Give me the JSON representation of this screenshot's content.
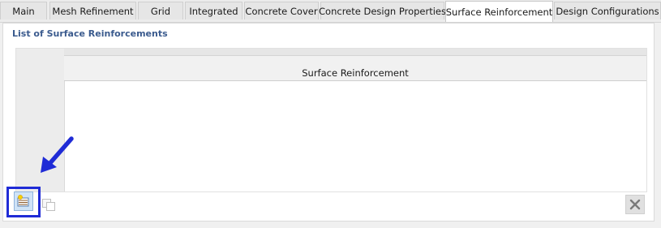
{
  "tabs": [
    {
      "label": "Main",
      "active": false
    },
    {
      "label": "Mesh Refinement",
      "active": false
    },
    {
      "label": "Grid",
      "active": false
    },
    {
      "label": "Integrated",
      "active": false
    },
    {
      "label": "Concrete Cover",
      "active": false
    },
    {
      "label": "Concrete Design Properties",
      "active": false
    },
    {
      "label": "Surface Reinforcement",
      "active": true
    },
    {
      "label": "Design Configurations",
      "active": false
    }
  ],
  "section": {
    "title": "List of Surface Reinforcements",
    "table": {
      "columns": [
        "Surface Reinforcement"
      ],
      "rows": []
    }
  },
  "toolbar": {
    "new_icon": "new-surface-reinforcement-icon",
    "copy_icon": "copy-icon",
    "delete_icon": "delete-icon"
  },
  "annotation": {
    "arrow_color": "#1f2bd6",
    "highlight_color": "#1f2bd6"
  }
}
